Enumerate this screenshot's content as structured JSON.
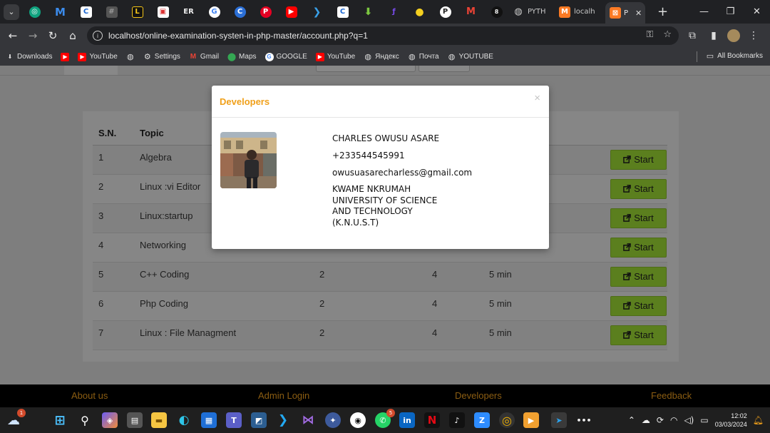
{
  "browser": {
    "url": "localhost/online-examination-systen-in-php-master/account.php?q=1",
    "tabs": [
      {
        "label": "PYTH",
        "icon": "globe-icon"
      },
      {
        "label": "localh",
        "icon": "xampp-icon"
      },
      {
        "label": "P",
        "icon": "xampp-icon"
      }
    ],
    "bookmarks": [
      {
        "label": "Downloads",
        "icon": "download-icon"
      },
      {
        "label": "",
        "icon": "youtube-icon"
      },
      {
        "label": "YouTube",
        "icon": "youtube-icon"
      },
      {
        "label": "",
        "icon": "globe-icon"
      },
      {
        "label": "Settings",
        "icon": "gear-icon"
      },
      {
        "label": "Gmail",
        "icon": "gmail-icon"
      },
      {
        "label": "Maps",
        "icon": "maps-icon"
      },
      {
        "label": "GOOGLE",
        "icon": "google-icon"
      },
      {
        "label": "YouTube",
        "icon": "youtube-icon"
      },
      {
        "label": "Яндекс",
        "icon": "globe-icon"
      },
      {
        "label": "Почта",
        "icon": "globe-icon"
      },
      {
        "label": "YOUTUBE",
        "icon": "globe-icon"
      }
    ],
    "all_bookmarks": "All Bookmarks"
  },
  "table": {
    "headers": {
      "sn": "S.N.",
      "topic": "Topic"
    },
    "start_label": "Start",
    "rows": [
      {
        "sn": "1",
        "topic": "Algebra",
        "questions": "",
        "marks": "",
        "time": ""
      },
      {
        "sn": "2",
        "topic": "Linux :vi Editor",
        "questions": "",
        "marks": "",
        "time": ""
      },
      {
        "sn": "3",
        "topic": "Linux:startup",
        "questions": "",
        "marks": "",
        "time": ""
      },
      {
        "sn": "4",
        "topic": "Networking",
        "questions": "",
        "marks": "",
        "time": ""
      },
      {
        "sn": "5",
        "topic": "C++ Coding",
        "questions": "2",
        "marks": "4",
        "time": "5 min"
      },
      {
        "sn": "6",
        "topic": "Php Coding",
        "questions": "2",
        "marks": "4",
        "time": "5 min"
      },
      {
        "sn": "7",
        "topic": "Linux : File Managment",
        "questions": "2",
        "marks": "4",
        "time": "5 min"
      }
    ]
  },
  "footer": {
    "about": "About us",
    "admin": "Admin Login",
    "developers": "Developers",
    "feedback": "Feedback"
  },
  "modal": {
    "title": "Developers",
    "close": "×",
    "name": "CHARLES OWUSU ASARE",
    "phone": "+233544545991",
    "email": "owusuasarecharless@gmail.com",
    "university_lines": [
      "KWAME NKRUMAH",
      "UNIVERSITY OF SCIENCE",
      "AND TECHNOLOGY",
      "(K.N.U.S.T)"
    ]
  },
  "taskbar": {
    "time": "12:02",
    "date": "03/03/2024",
    "whatsapp_badge": "5",
    "weather_badge": "1"
  },
  "colors": {
    "accent": "#f0a01a",
    "start_button": "#5b7f1e",
    "footer_link": "#8b5d12"
  }
}
